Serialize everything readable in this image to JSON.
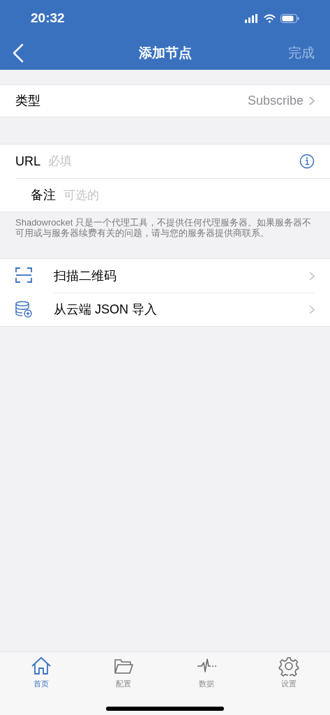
{
  "status_bar": {
    "time": "20:32"
  },
  "nav": {
    "title": "添加节点",
    "done": "完成",
    "done_disabled": true
  },
  "type_row": {
    "label": "类型",
    "value": "Subscribe"
  },
  "fields": [
    {
      "label": "URL",
      "placeholder": "必填",
      "kind": "info"
    },
    {
      "label": "备注",
      "placeholder": "可选的",
      "kind": "plain"
    }
  ],
  "note": "Shadowrocket 只是一个代理工具，不提供任何代理服务器。如果服务器不可用或与服务器续费有关的问题，请与您的服务器提供商联系。",
  "actions": [
    {
      "label": "扫描二维码",
      "kind": "scan"
    },
    {
      "label": "从云端 JSON 导入",
      "kind": "cloud"
    }
  ],
  "tabs": [
    {
      "label": "首页",
      "kind": "home",
      "selected": true
    },
    {
      "label": "配置",
      "kind": "folder",
      "selected": false
    },
    {
      "label": "数据",
      "kind": "pulse",
      "selected": false
    },
    {
      "label": "设置",
      "kind": "gear",
      "selected": false
    }
  ]
}
